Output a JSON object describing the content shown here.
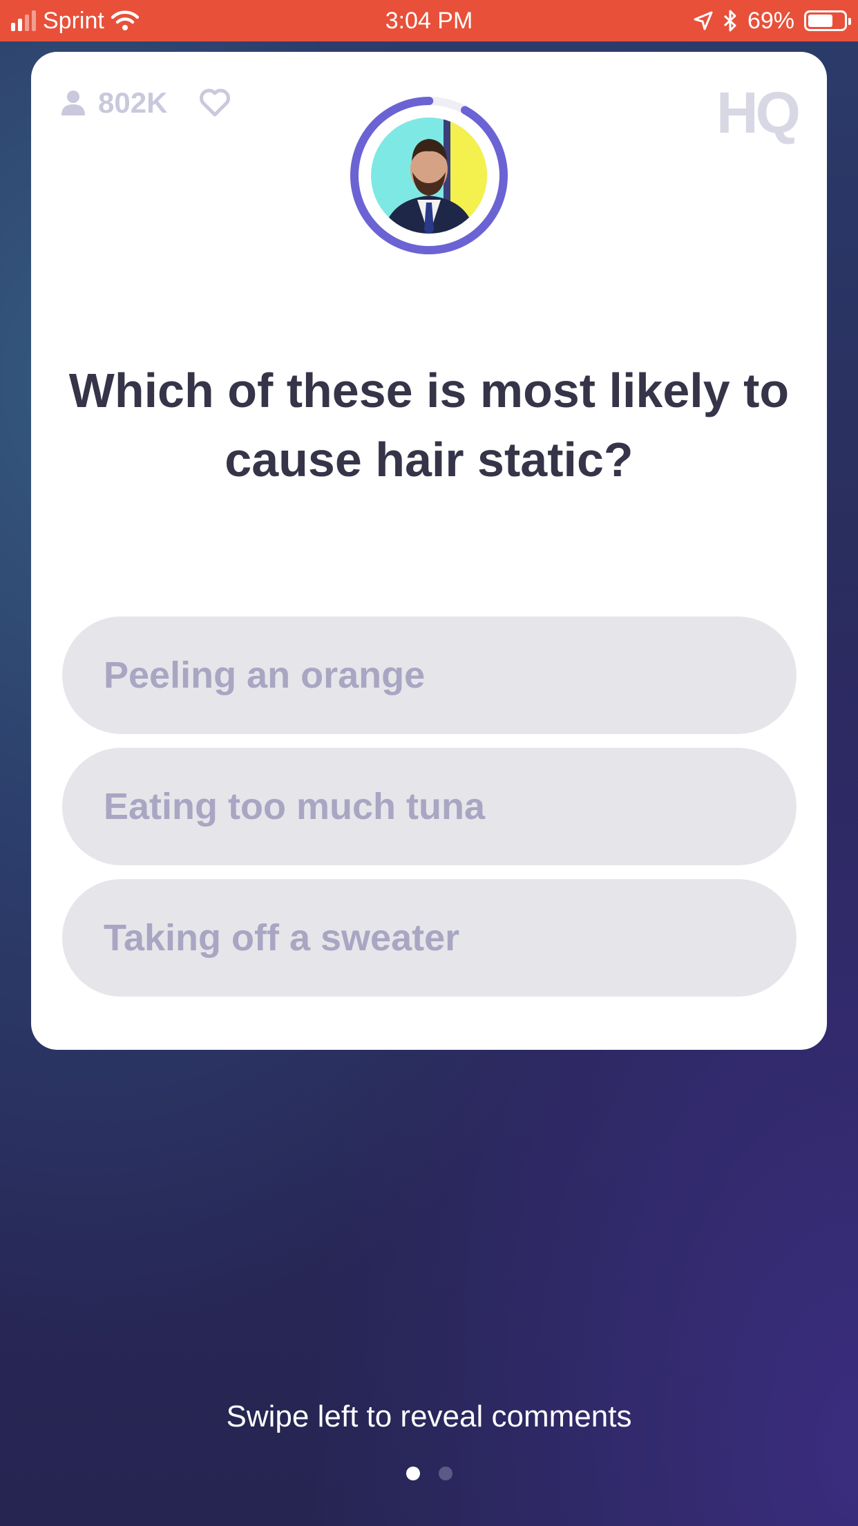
{
  "status_bar": {
    "carrier": "Sprint",
    "time": "3:04 PM",
    "battery_percent": "69%",
    "battery_level": 0.69,
    "icons": [
      "signal-icon",
      "wifi-icon",
      "location-icon",
      "bluetooth-icon",
      "battery-icon"
    ]
  },
  "card": {
    "viewer_count": "802K",
    "logo": "HQ",
    "timer_progress": 0.92,
    "question": "Which of these is most likely to cause hair static?",
    "answers": [
      {
        "label": "Peeling an orange"
      },
      {
        "label": "Eating too much tuna"
      },
      {
        "label": "Taking off a sweater"
      }
    ]
  },
  "footer": {
    "swipe_hint": "Swipe left to reveal comments",
    "page_count": 2,
    "active_page": 0
  },
  "colors": {
    "status_bar": "#e8503a",
    "timer_ring": "#6b63d3",
    "answer_bg": "#e6e5ea",
    "answer_text": "#a8a6c2",
    "question_text": "#353448"
  }
}
